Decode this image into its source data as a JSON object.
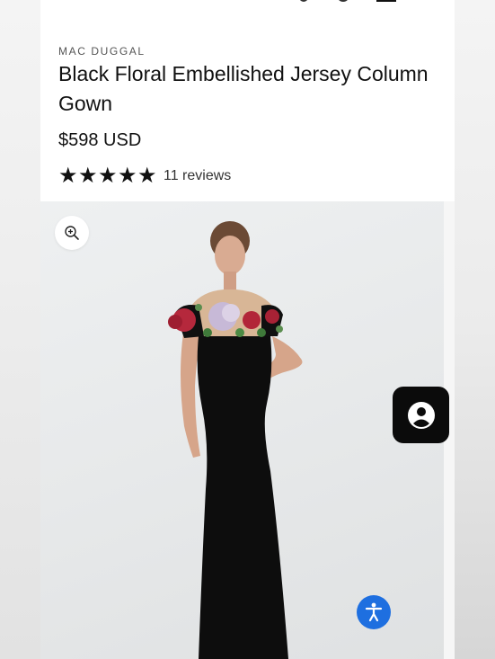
{
  "product": {
    "brand": "MAC DUGGAL",
    "title": "Black Floral Embellished Jersey Column Gown",
    "price": "$598 USD",
    "rating": 5,
    "reviews_label": "11 reviews"
  },
  "icons": {
    "zoom": "zoom-in-icon",
    "accessibility": "accessibility-icon",
    "account": "account-icon",
    "star": "star-icon"
  },
  "colors": {
    "accent_blue": "#1e6fe0",
    "dress": "#0d0d0d",
    "text": "#111111"
  }
}
